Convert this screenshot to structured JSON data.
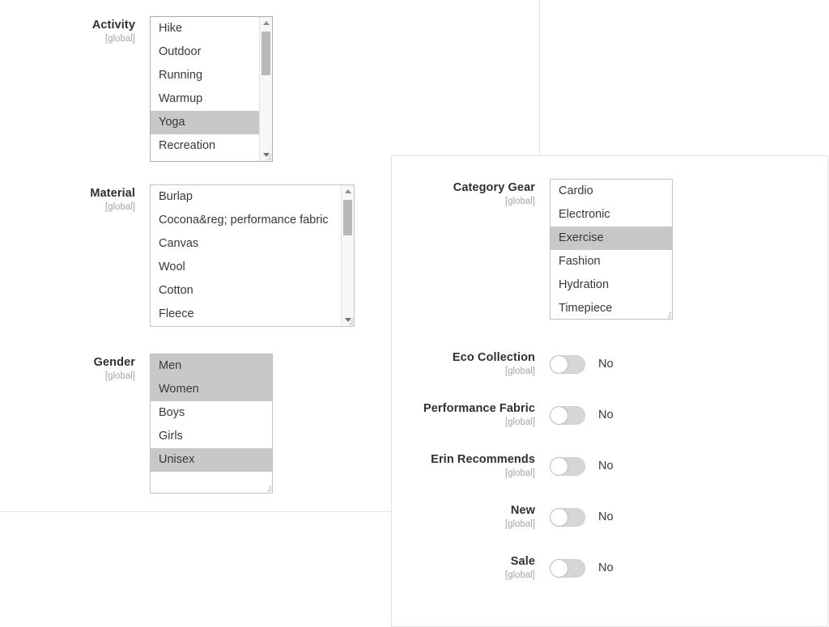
{
  "colors": {
    "panel_border": "#e3e3e3",
    "listbox_border": "#adadad",
    "option_selected_bg": "#c8c8c8",
    "label_text": "#303030",
    "scope_text": "#a6a6a6",
    "option_text": "#41362f",
    "switch_track_off": "#d6d6d6",
    "switch_knob": "#ffffff"
  },
  "scope_note": "[global]",
  "panel_activity": {
    "fields": [
      {
        "name": "activity",
        "label": "Activity",
        "scope": "[global]",
        "control": "multiselect",
        "has_scrollbar": true,
        "options": [
          {
            "label": "Hike",
            "selected": false
          },
          {
            "label": "Outdoor",
            "selected": false
          },
          {
            "label": "Running",
            "selected": false
          },
          {
            "label": "Warmup",
            "selected": false
          },
          {
            "label": "Yoga",
            "selected": true
          },
          {
            "label": "Recreation",
            "selected": false
          }
        ]
      },
      {
        "name": "material",
        "label": "Material",
        "scope": "[global]",
        "control": "multiselect",
        "has_scrollbar": true,
        "options": [
          {
            "label": "Burlap",
            "selected": false
          },
          {
            "label": "Cocona&reg; performance fabric",
            "selected": false
          },
          {
            "label": "Canvas",
            "selected": false
          },
          {
            "label": "Wool",
            "selected": false
          },
          {
            "label": "Cotton",
            "selected": false
          },
          {
            "label": "Fleece",
            "selected": false
          }
        ]
      },
      {
        "name": "gender",
        "label": "Gender",
        "scope": "[global]",
        "control": "multiselect",
        "has_scrollbar": false,
        "options": [
          {
            "label": "Men",
            "selected": true
          },
          {
            "label": "Women",
            "selected": true
          },
          {
            "label": "Boys",
            "selected": false
          },
          {
            "label": "Girls",
            "selected": false
          },
          {
            "label": "Unisex",
            "selected": true
          },
          {
            "label": "",
            "selected": false
          }
        ]
      }
    ]
  },
  "panel_gear": {
    "category_gear": {
      "name": "category-gear",
      "label": "Category Gear",
      "scope": "[global]",
      "control": "multiselect",
      "has_scrollbar": false,
      "options": [
        {
          "label": "Cardio",
          "selected": false
        },
        {
          "label": "Electronic",
          "selected": false
        },
        {
          "label": "Exercise",
          "selected": true
        },
        {
          "label": "Fashion",
          "selected": false
        },
        {
          "label": "Hydration",
          "selected": false
        },
        {
          "label": "Timepiece",
          "selected": false
        }
      ]
    },
    "switches": [
      {
        "name": "eco-collection",
        "label": "Eco Collection",
        "scope": "[global]",
        "state": "No",
        "on": false
      },
      {
        "name": "performance-fabric",
        "label": "Performance Fabric",
        "scope": "[global]",
        "state": "No",
        "on": false
      },
      {
        "name": "erin-recommends",
        "label": "Erin Recommends",
        "scope": "[global]",
        "state": "No",
        "on": false
      },
      {
        "name": "new",
        "label": "New",
        "scope": "[global]",
        "state": "No",
        "on": false
      },
      {
        "name": "sale",
        "label": "Sale",
        "scope": "[global]",
        "state": "No",
        "on": false
      }
    ]
  }
}
